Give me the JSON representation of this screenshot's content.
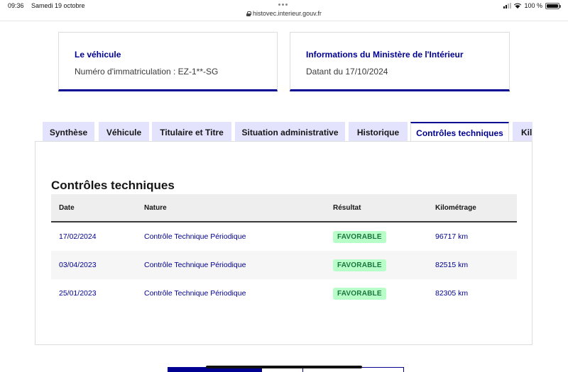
{
  "status_bar": {
    "time": "09:36",
    "date": "Samedi 19 octobre",
    "battery": "100 %",
    "battery_level": 1.0
  },
  "browser": {
    "url": "histovec.interieur.gouv.fr"
  },
  "cards": {
    "vehicule": {
      "title": "Le véhicule",
      "text": "Numéro d'immatriculation : EZ-1**-SG"
    },
    "ministere": {
      "title": "Informations du Ministère de l'Intérieur",
      "text": "Datant du 17/10/2024"
    }
  },
  "tabs": [
    {
      "label": "Synthèse",
      "active": false
    },
    {
      "label": "Véhicule",
      "active": false
    },
    {
      "label": "Titulaire et Titre",
      "active": false
    },
    {
      "label": "Situation administrative",
      "active": false
    },
    {
      "label": "Historique",
      "active": false
    },
    {
      "label": "Contrôles techniques",
      "active": true
    },
    {
      "label": "Kil",
      "active": false
    }
  ],
  "section": {
    "title": "Contrôles techniques"
  },
  "table": {
    "headers": [
      "Date",
      "Nature",
      "Résultat",
      "Kilométrage"
    ],
    "rows": [
      {
        "date": "17/02/2024",
        "nature": "Contrôle Technique Périodique",
        "result": "FAVORABLE",
        "km": "96717 km"
      },
      {
        "date": "03/04/2023",
        "nature": "Contrôle Technique Périodique",
        "result": "FAVORABLE",
        "km": "82515 km"
      },
      {
        "date": "25/01/2023",
        "nature": "Contrôle Technique Périodique",
        "result": "FAVORABLE",
        "km": "82305 km"
      }
    ]
  },
  "colors": {
    "accent": "#000091",
    "tab_bg": "#e3e3fd",
    "badge_bg": "#b8fec9",
    "badge_text": "#18753c"
  }
}
